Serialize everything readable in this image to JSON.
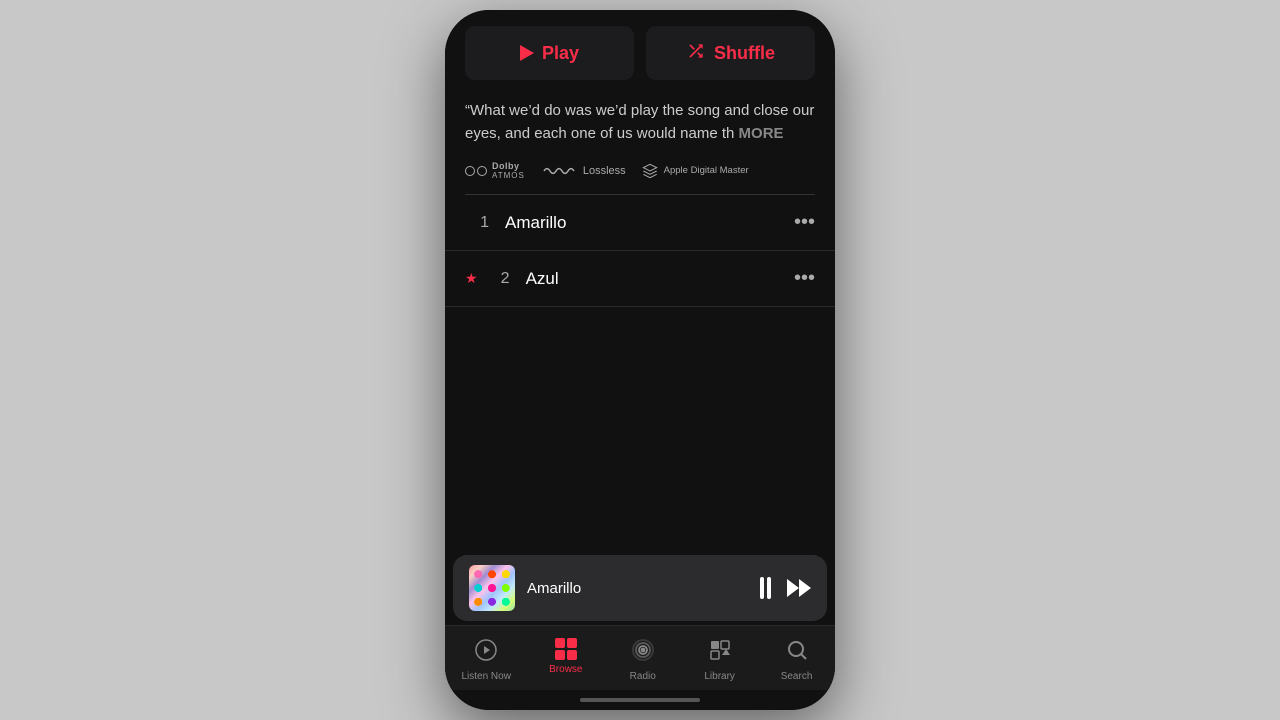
{
  "buttons": {
    "play_label": "Play",
    "shuffle_label": "Shuffle"
  },
  "quote": {
    "text": "“What we’d do was we’d play the song and close our eyes, and each one of us would name th",
    "more": "MORE"
  },
  "badges": {
    "dolby": "Dolby Atmos",
    "lossless": "Lossless",
    "adm": "Apple Digital Master"
  },
  "tracks": [
    {
      "num": "1",
      "star": false,
      "name": "Amarillo"
    },
    {
      "num": "2",
      "star": true,
      "name": "Azul"
    }
  ],
  "now_playing": {
    "title": "Amarillo"
  },
  "tabs": [
    {
      "id": "listen-now",
      "label": "Listen Now",
      "active": false
    },
    {
      "id": "browse",
      "label": "Browse",
      "active": true
    },
    {
      "id": "radio",
      "label": "Radio",
      "active": false
    },
    {
      "id": "library",
      "label": "Library",
      "active": false
    },
    {
      "id": "search",
      "label": "Search",
      "active": false
    }
  ],
  "colors": {
    "accent": "#fa2d48",
    "background": "#111111",
    "surface": "#1c1c1e",
    "text_primary": "#ffffff",
    "text_secondary": "#aaaaaa"
  }
}
